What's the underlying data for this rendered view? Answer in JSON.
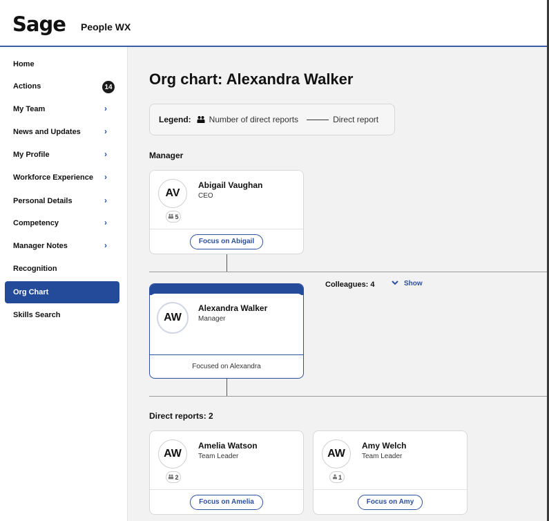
{
  "header": {
    "logo": "Sage",
    "product": "People WX"
  },
  "sidebar": {
    "items": [
      {
        "label": "Home"
      },
      {
        "label": "Actions",
        "badge": "14"
      },
      {
        "label": "My Team"
      },
      {
        "label": "News and Updates"
      },
      {
        "label": "My Profile"
      },
      {
        "label": "Workforce Experience"
      },
      {
        "label": "Personal Details"
      },
      {
        "label": "Competency"
      },
      {
        "label": "Manager Notes"
      },
      {
        "label": "Recognition"
      },
      {
        "label": "Org Chart",
        "active": true
      },
      {
        "label": "Skills Search"
      }
    ],
    "chevron": "›"
  },
  "main": {
    "title": "Org chart: Alexandra Walker",
    "legend": {
      "label": "Legend:",
      "reports_text": "Number of direct reports",
      "direct_text": "Direct report"
    },
    "manager_section": "Manager",
    "manager": {
      "initials": "AV",
      "name": "Abigail Vaughan",
      "role": "CEO",
      "reports": "5",
      "button": "Focus on Abigail"
    },
    "focused": {
      "initials": "AW",
      "name": "Alexandra Walker",
      "role": "Manager",
      "footer": "Focused on Alexandra"
    },
    "colleagues": {
      "label": "Colleagues: 4",
      "show": "Show"
    },
    "direct_section": "Direct reports: 2",
    "reports": [
      {
        "initials": "AW",
        "name": "Amelia Watson",
        "role": "Team Leader",
        "reports": "2",
        "button": "Focus on Amelia"
      },
      {
        "initials": "AW",
        "name": "Amy Welch",
        "role": "Team Leader",
        "reports": "1",
        "button": "Focus on Amy"
      }
    ]
  },
  "colors": {
    "brand_blue": "#244b9a",
    "link_blue": "#2b4f9c",
    "background": "#f2f2f3"
  }
}
